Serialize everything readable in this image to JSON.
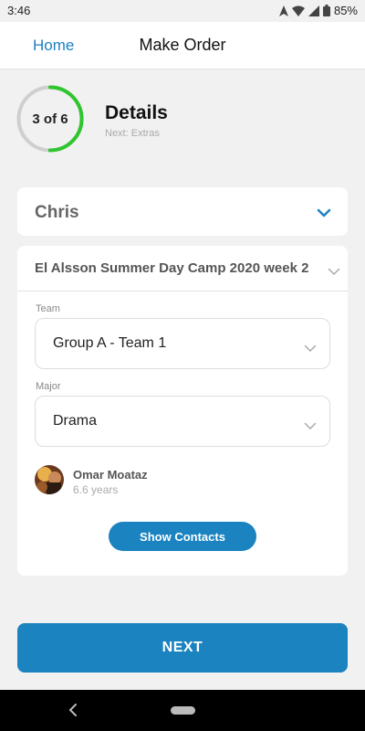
{
  "status_bar": {
    "time": "3:46",
    "battery": "85%"
  },
  "app_bar": {
    "home_label": "Home",
    "title": "Make Order"
  },
  "progress": {
    "label": "3 of 6",
    "current": 3,
    "total": 6,
    "title": "Details",
    "next": "Next: Extras",
    "accent_color": "#2ec52e"
  },
  "person": {
    "name": "Chris"
  },
  "camp": {
    "name": "El Alsson Summer Day Camp 2020 week 2"
  },
  "team": {
    "label": "Team",
    "value": "Group A - Team 1"
  },
  "major": {
    "label": "Major",
    "value": "Drama"
  },
  "contact": {
    "name": "Omar Moataz",
    "age": "6.6 years"
  },
  "buttons": {
    "show_contacts": "Show Contacts",
    "next": "NEXT"
  },
  "colors": {
    "primary": "#1a83c0",
    "link": "#1f80c0"
  }
}
